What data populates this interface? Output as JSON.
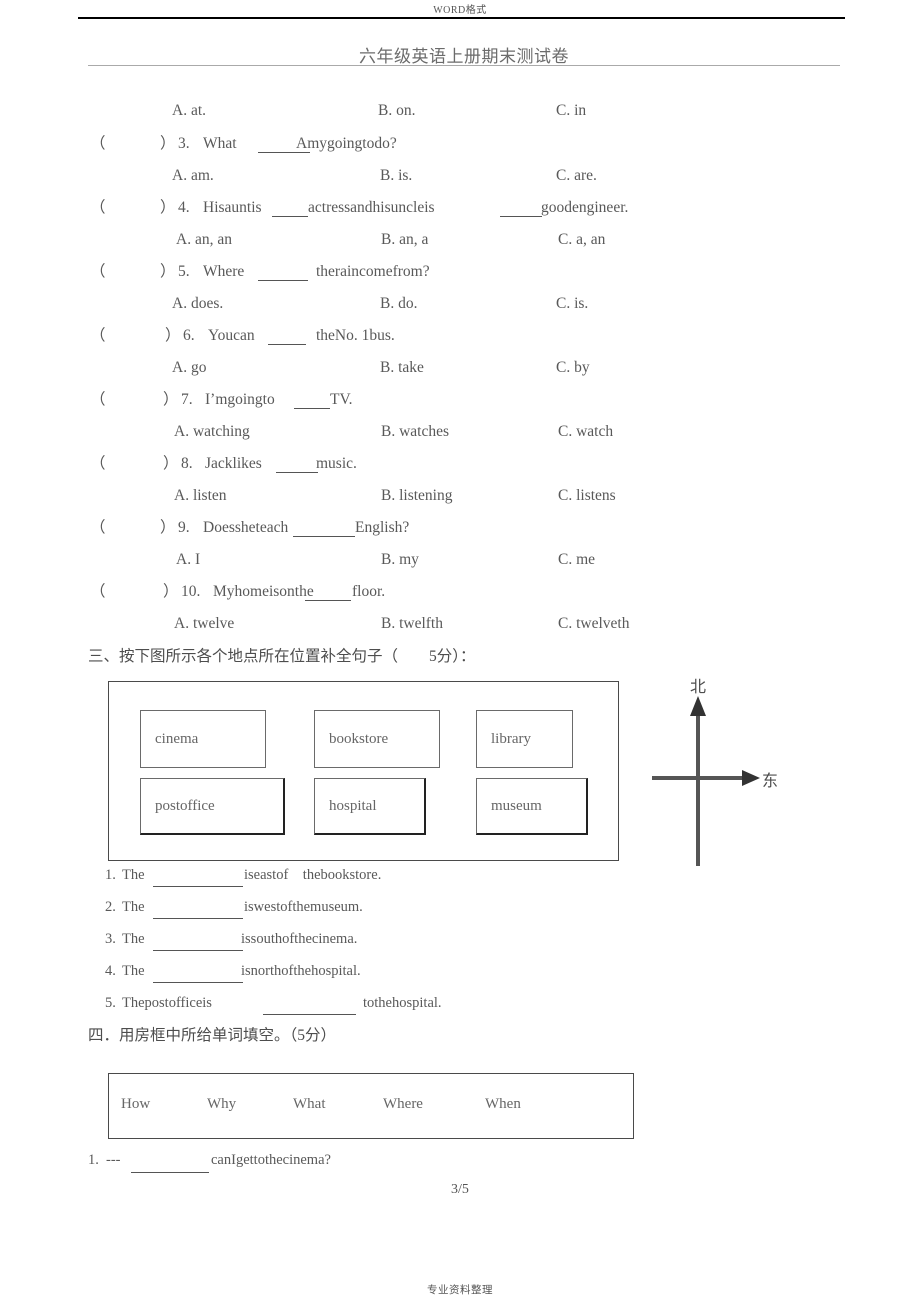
{
  "header": {
    "watermark": "WORD格式",
    "title": "六年级英语上册期末测试卷"
  },
  "footer": {
    "page_number": "3/5",
    "note": "专业资料整理"
  },
  "multiple_choice": {
    "carryover_options": {
      "a": "A. at.",
      "b": "B. on.",
      "c": "C. in"
    },
    "questions": [
      {
        "paren_open": "（",
        "paren_close": "）",
        "number": "3.",
        "stem_before": "What",
        "stem_after": "Amygoingtodo?",
        "a": "A. am.",
        "b": "B. is.",
        "c": "C. are."
      },
      {
        "paren_open": "（",
        "paren_close": "）",
        "number": "4.",
        "stem_before": "Hisauntis",
        "stem_mid": "actressandhisuncleis",
        "stem_after": "goodengineer.",
        "a": "A. an, an",
        "b": "B. an, a",
        "c": "C. a, an"
      },
      {
        "paren_open": "（",
        "paren_close": "）",
        "number": "5.",
        "stem_before": "Where",
        "stem_after": "theraincomefrom?",
        "a": "A. does.",
        "b": "B. do.",
        "c": "C. is."
      },
      {
        "paren_open": "（",
        "paren_close": "）",
        "number": "6.",
        "stem_before": "Youcan",
        "stem_after": "theNo. 1bus.",
        "a": "A. go",
        "b": "B. take",
        "c": "C. by"
      },
      {
        "paren_open": "（",
        "paren_close": "）",
        "number": "7.",
        "stem_before": "I’mgoingto",
        "stem_after": "TV.",
        "a": "A. watching",
        "b": "B. watches",
        "c": "C. watch"
      },
      {
        "paren_open": "（",
        "paren_close": "）",
        "number": "8.",
        "stem_before": "Jacklikes",
        "stem_after": "music.",
        "a": "A. listen",
        "b": "B. listening",
        "c": "C. listens"
      },
      {
        "paren_open": "（",
        "paren_close": "）",
        "number": "9.",
        "stem_before": "Doessheteach",
        "stem_after": "English?",
        "a": "A. I",
        "b": "B. my",
        "c": "C. me"
      },
      {
        "paren_open": "（",
        "paren_close": "）",
        "number": "10.",
        "stem_before": "Myhomeisonthe",
        "stem_after": "floor.",
        "a": "A. twelve",
        "b": "B. twelfth",
        "c": "C. twelveth"
      }
    ]
  },
  "section_three": {
    "heading": "三、按下图所示各个地点所在位置补全句子（        5分）：",
    "map": {
      "top_row": [
        "cinema",
        "bookstore",
        "library"
      ],
      "bottom_row": [
        "postoffice",
        "hospital",
        "museum"
      ]
    },
    "compass": {
      "north_label": "北",
      "east_label": "东"
    },
    "sentences": [
      {
        "number": "1.",
        "before": "The",
        "after": "iseastof    thebookstore."
      },
      {
        "number": "2.",
        "before": "The",
        "after": "iswestofthemuseum."
      },
      {
        "number": "3.",
        "before": "The",
        "after": "issouthofthecinema."
      },
      {
        "number": "4.",
        "before": "The",
        "after": "isnorthofthehospital."
      },
      {
        "number": "5.",
        "before": "Thepostofficeis",
        "after": "tothehospital."
      }
    ]
  },
  "section_four": {
    "heading": "四．用房框中所给单词填空。（5分）",
    "word_bank": [
      "How",
      "Why",
      "What",
      "Where",
      "When"
    ],
    "items": [
      {
        "number": "1.",
        "dash": "---",
        "text": "canIgettothecinema?"
      }
    ]
  }
}
